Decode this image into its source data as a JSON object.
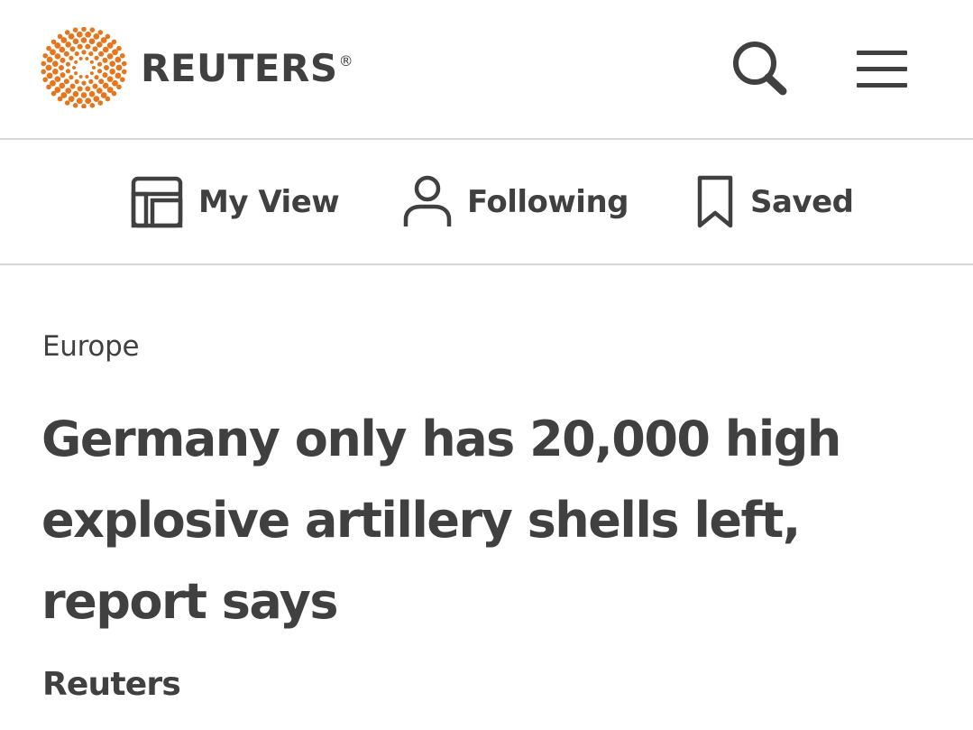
{
  "header": {
    "logo_text": "REUTERS",
    "logo_registered": "®",
    "logo_icon": "reuters-dot-ring-logo",
    "search_icon": "search-icon",
    "menu_icon": "hamburger-menu-icon"
  },
  "subnav": {
    "items": [
      {
        "label": "My View",
        "icon": "layout-icon"
      },
      {
        "label": "Following",
        "icon": "person-icon"
      },
      {
        "label": "Saved",
        "icon": "bookmark-icon"
      }
    ]
  },
  "article": {
    "section": "Europe",
    "headline": "Germany only has 20,000 high explosive artillery shells left, report says",
    "byline": "Reuters"
  },
  "colors": {
    "brand_orange": "#e6761e",
    "text": "#404040",
    "divider": "#d9d9d9",
    "background": "#ffffff"
  }
}
